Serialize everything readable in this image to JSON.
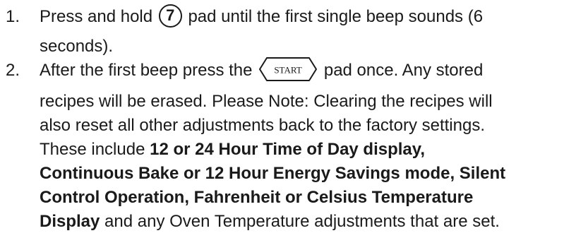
{
  "steps": [
    {
      "number": "1.",
      "lines": {
        "l1_before": "Press and hold",
        "l1_pad": "7",
        "l1_after": "pad until the first single beep sounds (6",
        "l2": "seconds)."
      }
    },
    {
      "number": "2.",
      "lines": {
        "l1_before": "After the first beep press the",
        "l1_pad": "START",
        "l1_after": "pad once. Any stored",
        "l2": "recipes will be erased. Please Note: Clearing the recipes will",
        "l3": "also reset all other adjustments back to the factory settings.",
        "l4_plain": "These include",
        "l4_bold": "12 or 24 Hour Time of Day display,",
        "l5_bold": "Continuous Bake or 12 Hour Energy Savings mode, Silent",
        "l6_bold": "Control Operation, Fahrenheit or Celsius Temperature",
        "l7_bold": "Display",
        "l7_plain": "and any Oven Temperature adjustments that are set."
      }
    }
  ]
}
